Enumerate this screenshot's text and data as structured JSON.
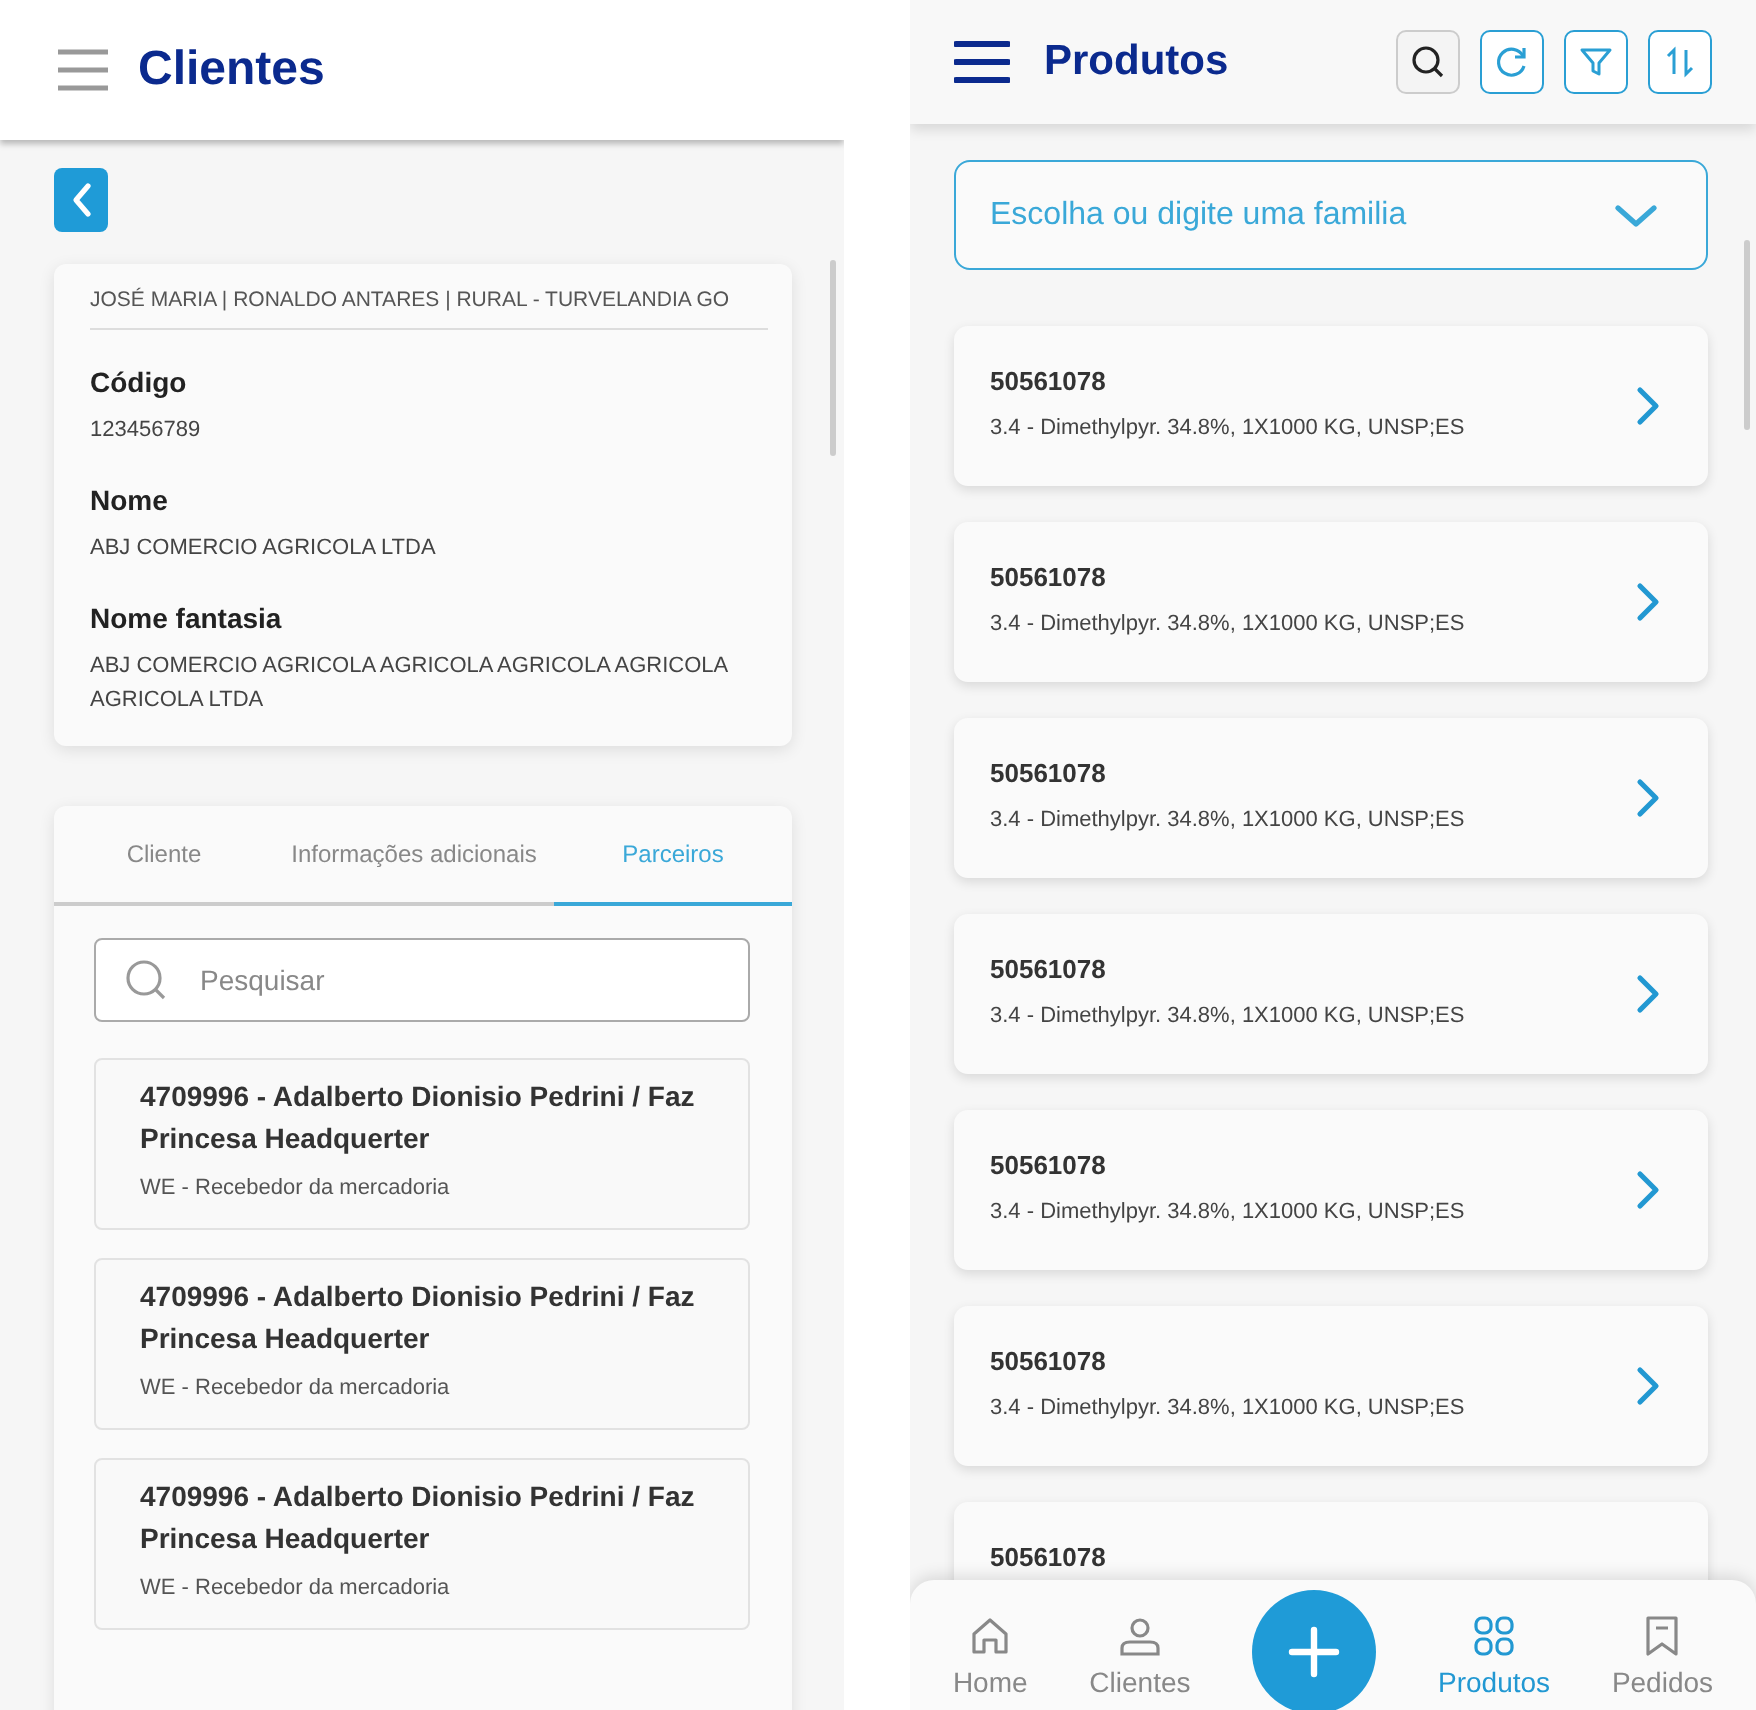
{
  "clientes": {
    "title": "Clientes",
    "summary": "JOSÉ MARIA | RONALDO ANTARES | RURAL - TURVELANDIA GO",
    "fields": [
      {
        "label": "Código",
        "value": "123456789"
      },
      {
        "label": "Nome",
        "value": "ABJ COMERCIO AGRICOLA LTDA"
      },
      {
        "label": "Nome fantasia",
        "value": "ABJ COMERCIO AGRICOLA AGRICOLA AGRICOLA AGRICOLA AGRICOLA LTDA"
      }
    ],
    "tabs": [
      {
        "label": "Cliente",
        "selected": false
      },
      {
        "label": "Informações adicionais",
        "selected": false
      },
      {
        "label": "Parceiros",
        "selected": true
      }
    ],
    "search": {
      "placeholder": "Pesquisar"
    },
    "partners": [
      {
        "title": "4709996 - Adalberto Dionisio Pedrini / Faz Princesa Headquerter",
        "role": "WE - Recebedor da mercadoria"
      },
      {
        "title": "4709996 - Adalberto Dionisio Pedrini / Faz Princesa Headquerter",
        "role": "WE - Recebedor da mercadoria"
      },
      {
        "title": "4709996 - Adalberto Dionisio Pedrini / Faz Princesa Headquerter",
        "role": "WE - Recebedor da mercadoria"
      }
    ]
  },
  "produtos": {
    "title": "Produtos",
    "family_select": {
      "placeholder": "Escolha ou digite uma familia"
    },
    "products": [
      {
        "code": "50561078",
        "description": "3.4 - Dimethylpyr. 34.8%, 1X1000 KG, UNSP;ES"
      },
      {
        "code": "50561078",
        "description": "3.4 - Dimethylpyr. 34.8%, 1X1000 KG, UNSP;ES"
      },
      {
        "code": "50561078",
        "description": "3.4 - Dimethylpyr. 34.8%, 1X1000 KG, UNSP;ES"
      },
      {
        "code": "50561078",
        "description": "3.4 - Dimethylpyr. 34.8%, 1X1000 KG, UNSP;ES"
      },
      {
        "code": "50561078",
        "description": "3.4 - Dimethylpyr. 34.8%, 1X1000 KG, UNSP;ES"
      },
      {
        "code": "50561078",
        "description": "3.4 - Dimethylpyr. 34.8%, 1X1000 KG, UNSP;ES"
      },
      {
        "code": "50561078"
      }
    ],
    "nav": [
      {
        "label": "Home",
        "selected": false
      },
      {
        "label": "Clientes",
        "selected": false
      },
      {
        "label": "Produtos",
        "selected": true
      },
      {
        "label": "Pedidos",
        "selected": false
      }
    ]
  }
}
